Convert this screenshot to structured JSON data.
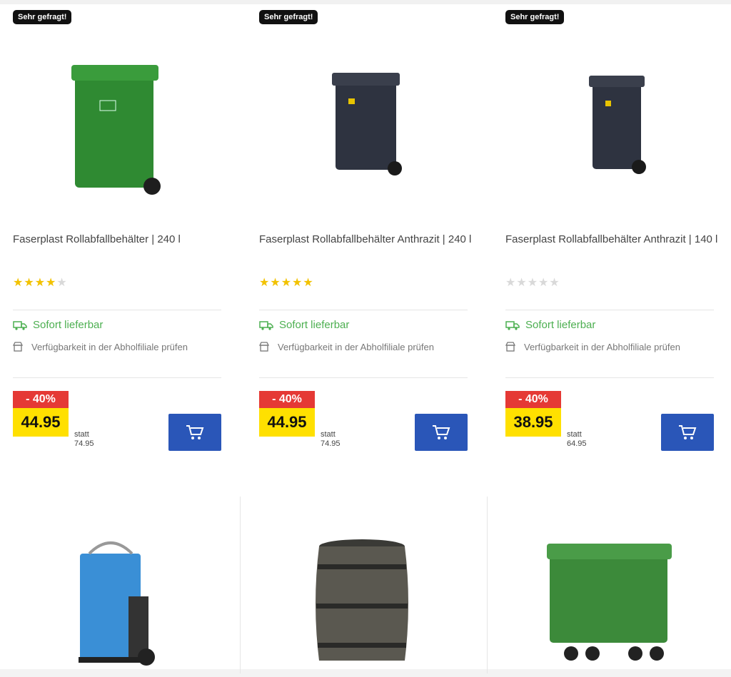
{
  "products": [
    {
      "badge": "Sehr gefragt!",
      "title": "Faserplast Rollabfallbehälter | 240 l",
      "rating": 4,
      "stock": "Sofort lieferbar",
      "store_check": "Verfügbarkeit in der Abholfiliale prüfen",
      "discount": "- 40%",
      "price": "44.95",
      "statt_label": "statt",
      "old_price": "74.95",
      "bin_color": "#2f8a32"
    },
    {
      "badge": "Sehr gefragt!",
      "title": "Faserplast Rollabfallbehälter Anthrazit | 240 l",
      "rating": 5,
      "stock": "Sofort lieferbar",
      "store_check": "Verfügbarkeit in der Abholfiliale prüfen",
      "discount": "- 40%",
      "price": "44.95",
      "statt_label": "statt",
      "old_price": "74.95",
      "bin_color": "#2e3340"
    },
    {
      "badge": "Sehr gefragt!",
      "title": "Faserplast Rollabfallbehälter Anthrazit | 140 l",
      "rating": 0,
      "stock": "Sofort lieferbar",
      "store_check": "Verfügbarkeit in der Abholfiliale prüfen",
      "discount": "- 40%",
      "price": "38.95",
      "statt_label": "statt",
      "old_price": "64.95",
      "bin_color": "#2e3340"
    }
  ],
  "bottom_products": [
    {
      "image": "blue-cart-bin"
    },
    {
      "image": "wooden-rain-barrel"
    },
    {
      "image": "green-large-container"
    }
  ],
  "colors": {
    "accent_blue": "#2a56b8",
    "discount_red": "#e53935",
    "price_yellow": "#ffe000",
    "stock_green": "#4caf50"
  }
}
